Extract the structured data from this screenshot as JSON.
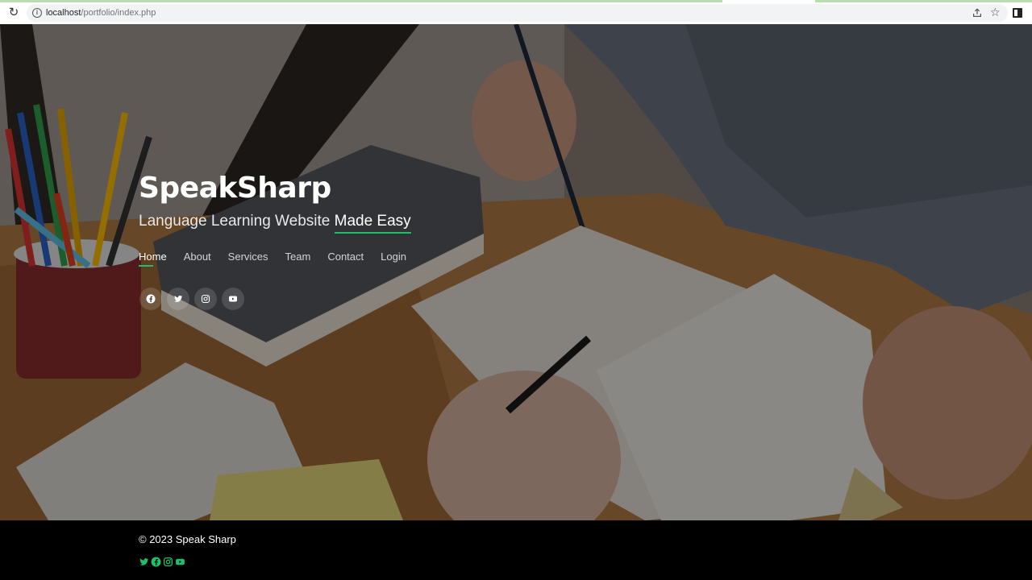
{
  "browser": {
    "url_host": "localhost",
    "url_path": "/portfolio/index.php"
  },
  "hero": {
    "brand": "SpeakSharp",
    "tagline_prefix": "Language Learning Website ",
    "tagline_accent": "Made Easy",
    "nav": [
      {
        "label": "Home",
        "active": true
      },
      {
        "label": "About"
      },
      {
        "label": "Services"
      },
      {
        "label": "Team"
      },
      {
        "label": "Contact"
      },
      {
        "label": "Login"
      }
    ],
    "social_icons": [
      "facebook-icon",
      "twitter-icon",
      "instagram-icon",
      "youtube-icon"
    ]
  },
  "footer": {
    "copyright": "© 2023 Speak Sharp",
    "social_icons": [
      "twitter-icon",
      "facebook-icon",
      "instagram-icon",
      "youtube-icon"
    ],
    "icon_color": "#1fbf6a"
  },
  "colors": {
    "accent": "#1fbf6a"
  }
}
